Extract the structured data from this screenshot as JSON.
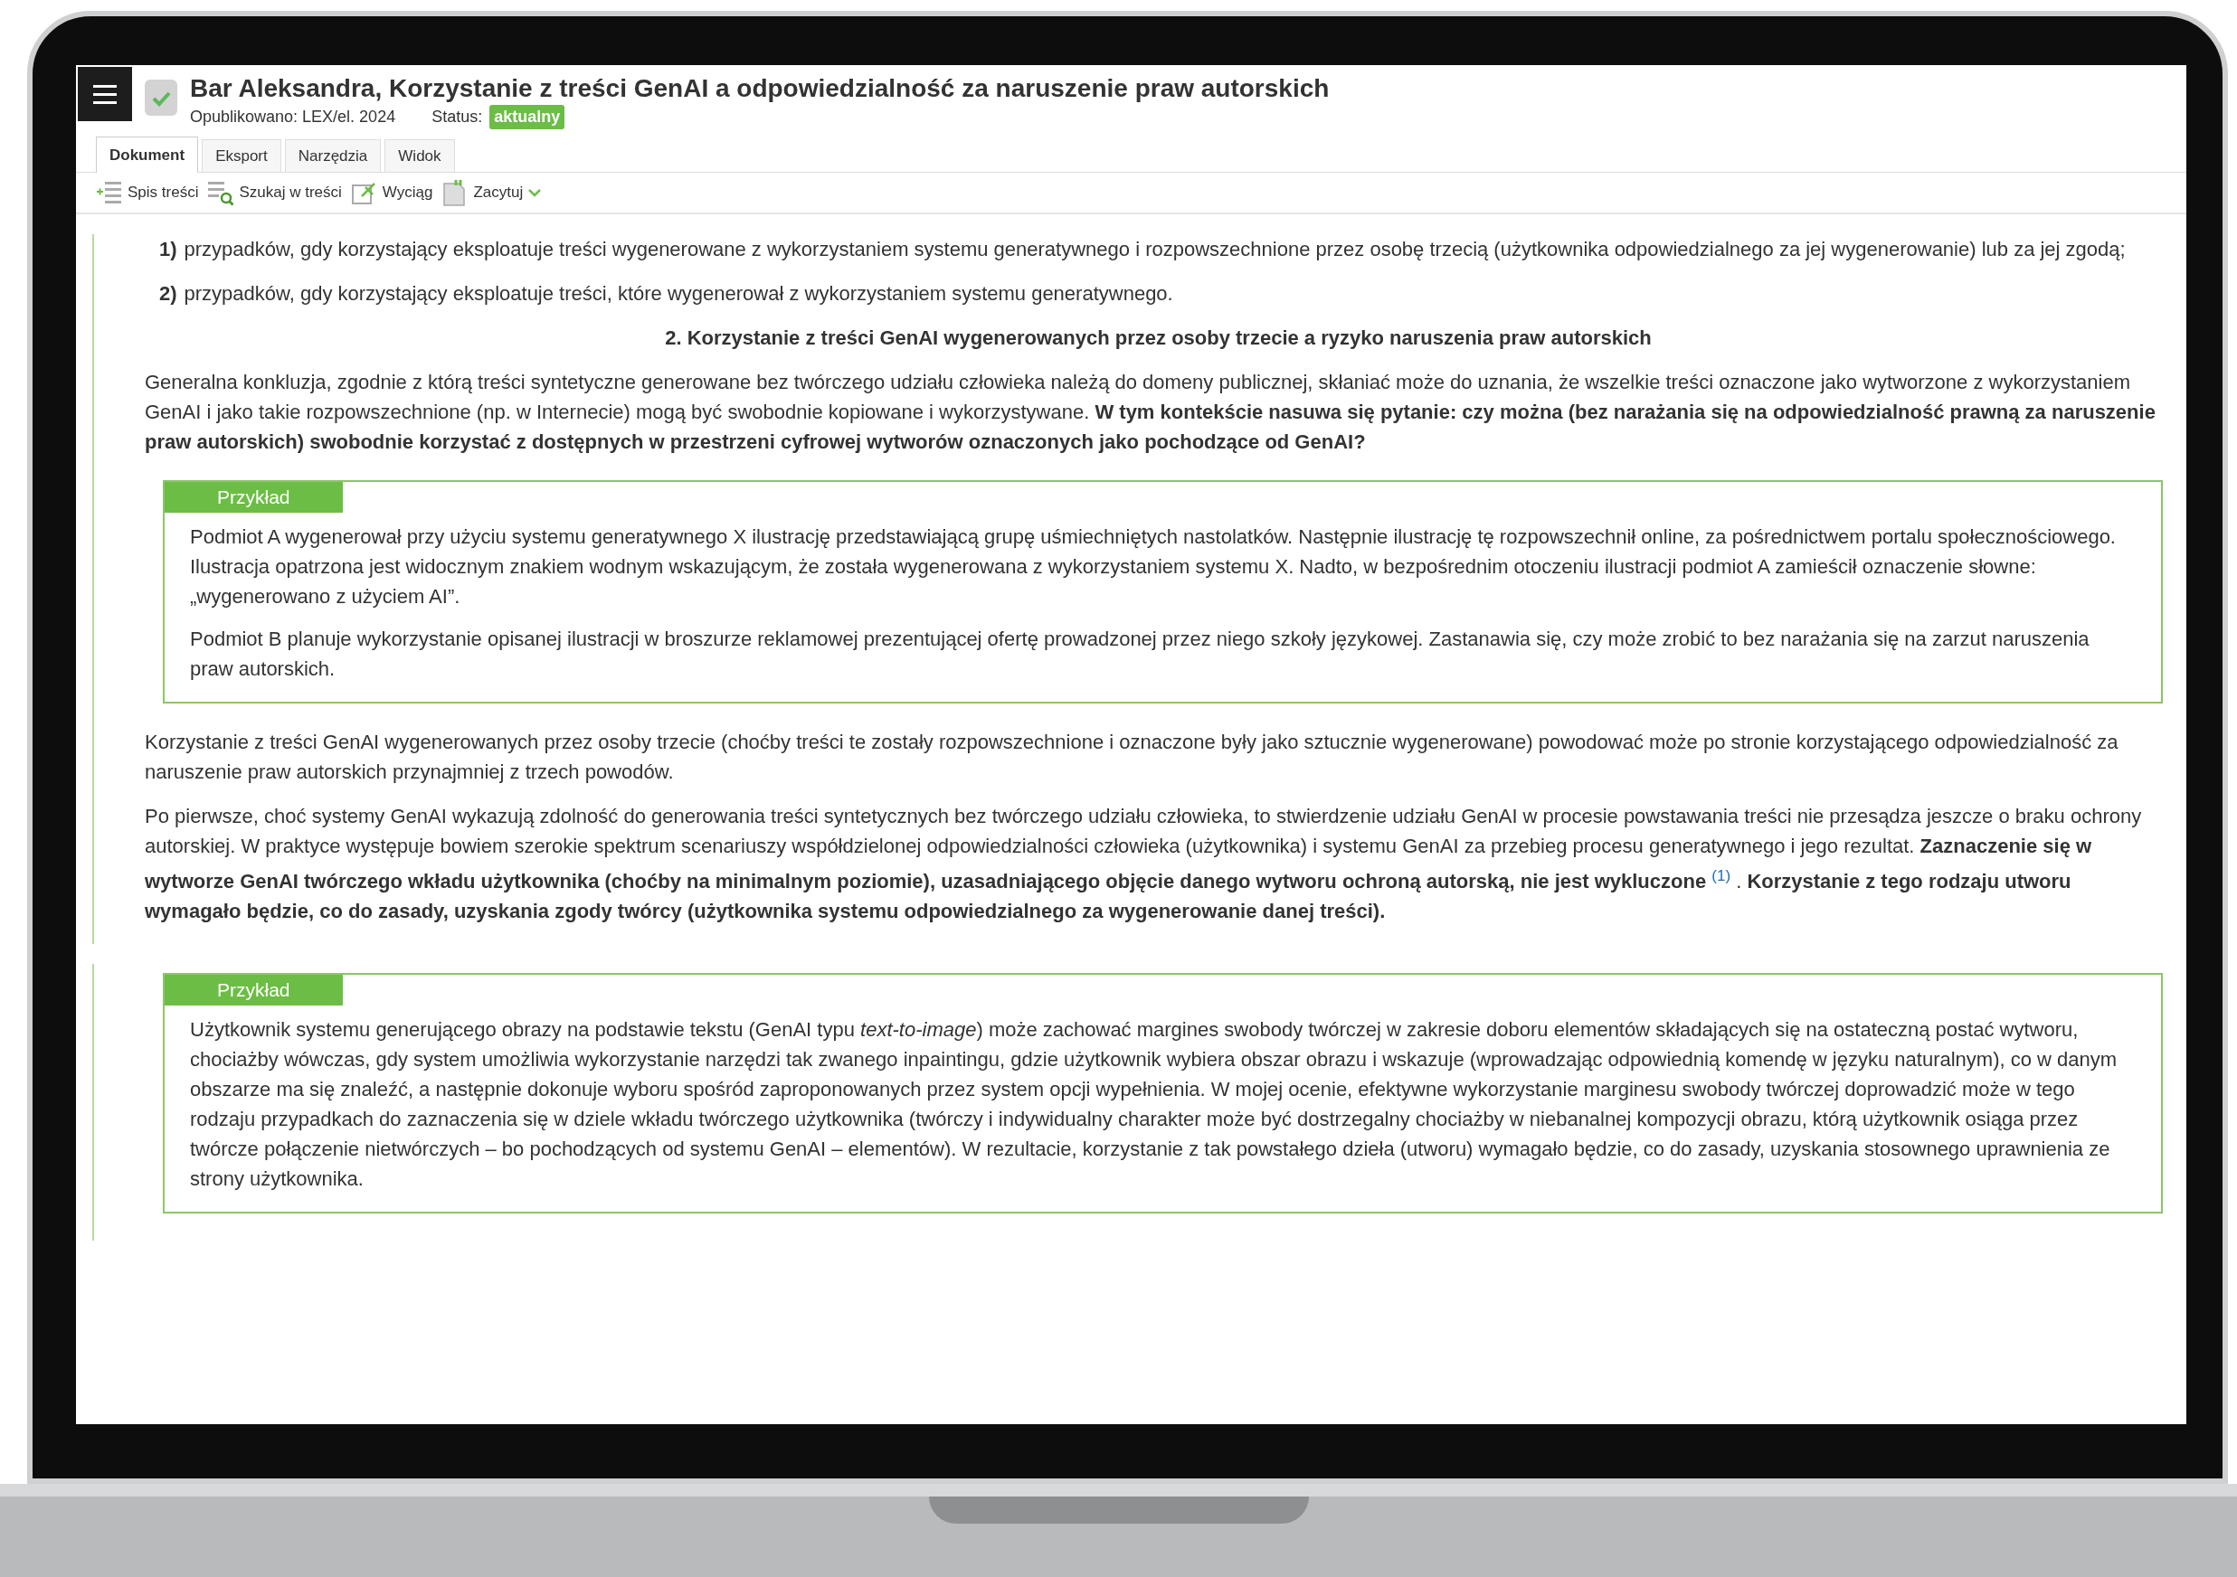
{
  "header": {
    "title": "Bar Aleksandra, Korzystanie z treści GenAI a odpowiedzialność za naruszenie praw autorskich",
    "published": "Opublikowano: LEX/el. 2024",
    "status_label": "Status:",
    "status_badge": "aktualny"
  },
  "tabs": [
    {
      "label": "Dokument",
      "selected": true
    },
    {
      "label": "Eksport",
      "selected": false
    },
    {
      "label": "Narzędzia",
      "selected": false
    },
    {
      "label": "Widok",
      "selected": false
    }
  ],
  "toolbar": [
    {
      "kind": "toc",
      "label": "Spis treści",
      "has_menu": false
    },
    {
      "kind": "search",
      "label": "Szukaj w treści",
      "has_menu": false
    },
    {
      "kind": "excerpt",
      "label": "Wyciąg",
      "has_menu": false
    },
    {
      "kind": "quote",
      "label": "Zacytuj",
      "has_menu": true
    }
  ],
  "sections": [
    {
      "blocks": [
        {
          "kind": "list_item",
          "number": "1)",
          "text": "przypadków, gdy korzystający eksploatuje treści wygenerowane z wykorzystaniem systemu generatywnego i rozpowszechnione przez osobę trzecią (użytkownika odpowiedzialnego za jej wygenerowanie) lub za jej zgodą;"
        },
        {
          "kind": "list_item",
          "number": "2)",
          "text": "przypadków, gdy korzystający eksploatuje treści, które wygenerował z wykorzystaniem systemu generatywnego."
        },
        {
          "kind": "heading",
          "text": "2. Korzystanie z treści GenAI wygenerowanych przez osoby trzecie a ryzyko naruszenia praw autorskich"
        },
        {
          "kind": "paragraph",
          "text": "Generalna konkluzja, zgodnie z którą treści syntetyczne generowane bez twórczego udziału człowieka należą do domeny publicznej, skłaniać może do uznania, że wszelkie treści oznaczone jako wytworzone z wykorzystaniem GenAI i jako takie rozpowszechnione (np. w Internecie) mogą być swobodnie kopiowane i wykorzystywane. **W tym kontekście nasuwa się pytanie: czy można (bez narażania się na odpowiedzialność prawną za naruszenie praw autorskich) swobodnie korzystać z dostępnych w przestrzeni cyfrowej wytworów oznaczonych jako pochodzące od GenAI?**"
        },
        {
          "kind": "example",
          "label": "Przykład",
          "paragraphs": [
            "Podmiot A wygenerował przy użyciu systemu generatywnego X ilustrację przedstawiającą grupę uśmiechniętych nastolatków. Następnie ilustrację tę rozpowszechnił online, za pośrednictwem portalu społecznościowego. Ilustracja opatrzona jest widocznym znakiem wodnym wskazującym, że została wygenerowana z wykorzystaniem systemu X. Nadto, w bezpośrednim otoczeniu ilustracji podmiot A zamieścił oznaczenie słowne: „wygenerowano z użyciem AI”.",
            "Podmiot B planuje wykorzystanie opisanej ilustracji w broszurze reklamowej prezentującej ofertę prowadzonej przez niego szkoły językowej. Zastanawia się, czy może zrobić to bez narażania się na zarzut naruszenia praw autorskich."
          ]
        },
        {
          "kind": "paragraph",
          "text": "Korzystanie z treści GenAI wygenerowanych przez osoby trzecie (choćby treści te zostały rozpowszechnione i oznaczone były jako sztucznie wygenerowane) powodować może po stronie korzystającego odpowiedzialność za naruszenie praw autorskich przynajmniej z trzech powodów."
        },
        {
          "kind": "paragraph",
          "text": "Po pierwsze, choć systemy GenAI wykazują zdolność do generowania treści syntetycznych bez twórczego udziału człowieka, to stwierdzenie udziału GenAI w procesie powstawania treści nie przesądza jeszcze o braku ochrony autorskiej. W praktyce występuje bowiem szerokie spektrum scenariuszy współdzielonej odpowiedzialności człowieka (użytkownika) i systemu GenAI za przebieg procesu generatywnego i jego rezultat. **Zaznaczenie się w wytworze GenAI twórczego wkładu użytkownika (choćby na minimalnym poziomie), uzasadniającego objęcie danego wytworu ochroną autorską, nie jest wykluczone**",
          "footnote": "(1)",
          "text_after": " . **Korzystanie z tego rodzaju utworu wymagało będzie, co do zasady, uzyskania zgody twórcy (użytkownika systemu odpowiedzialnego za wygenerowanie danej treści).**"
        }
      ]
    },
    {
      "blocks": [
        {
          "kind": "example",
          "label": "Przykład",
          "paragraphs": [
            "Użytkownik systemu generującego obrazy na podstawie tekstu (GenAI typu *text-to-image*) może zachować margines swobody twórczej w zakresie doboru elementów składających się na ostateczną postać wytworu, chociażby wówczas, gdy system umożliwia wykorzystanie narzędzi tak zwanego inpaintingu, gdzie użytkownik wybiera obszar obrazu i wskazuje (wprowadzając odpowiednią komendę w języku naturalnym), co w danym obszarze ma się znaleźć, a następnie dokonuje wyboru spośród zaproponowanych przez system opcji wypełnienia. W mojej ocenie, efektywne wykorzystanie marginesu swobody twórczej doprowadzić może w tego rodzaju przypadkach do zaznaczenia się w dziele wkładu twórczego użytkownika (twórczy i indywidualny charakter może być dostrzegalny chociażby w niebanalnej kompozycji obrazu, którą użytkownik osiąga przez twórcze połączenie nietwórczych – bo pochodzących od systemu GenAI – elementów). W rezultacie, korzystanie z tak powstałego dzieła (utworu) wymagało będzie, co do zasady, uzyskania stosownego uprawnienia ze strony użytkownika."
          ]
        }
      ]
    }
  ]
}
